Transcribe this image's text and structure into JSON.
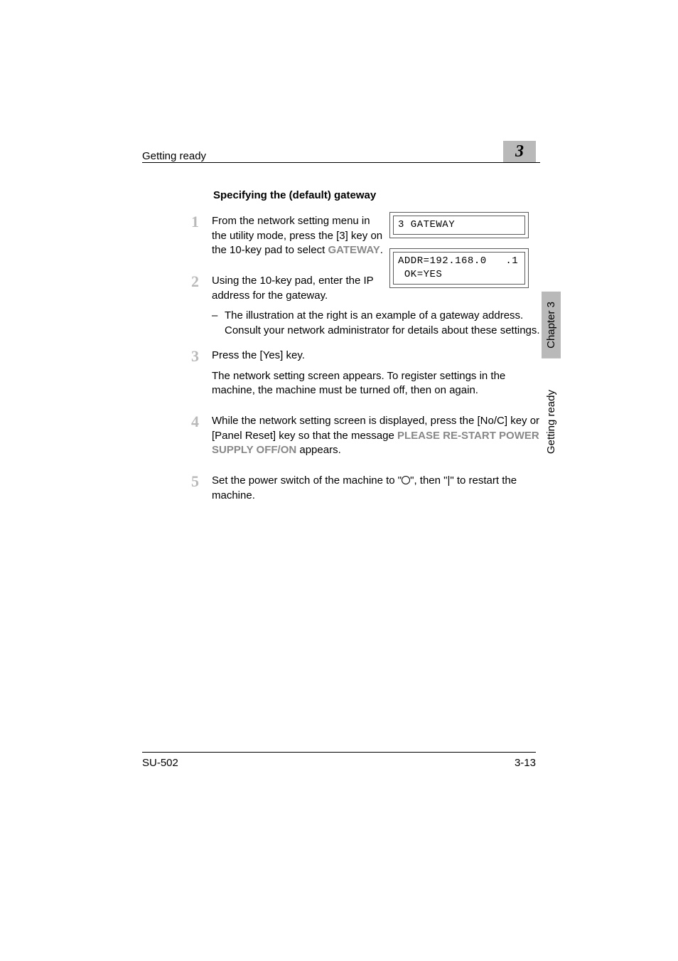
{
  "header": {
    "left": "Getting ready",
    "right_num": "3"
  },
  "section_title": "Specifying the (default) gateway",
  "illus": {
    "box1": "3 GATEWAY",
    "box2_line1": "ADDR=192.168.0   .1",
    "box2_line2": " OK=YES"
  },
  "steps": [
    {
      "num": "1",
      "paras": [
        {
          "segments": [
            {
              "t": "From the network setting menu in the utility mode, press the [3] key on the 10-key pad to select "
            },
            {
              "t": "GATEWAY",
              "gray": true
            },
            {
              "t": "."
            }
          ]
        }
      ]
    },
    {
      "num": "2",
      "paras": [
        {
          "segments": [
            {
              "t": "Using the 10-key pad, enter the IP address for the gateway."
            }
          ]
        }
      ],
      "sub": [
        {
          "segments": [
            {
              "t": "The illustration at the right is an example of a gateway address. Consult your network administrator for details about these settings."
            }
          ]
        }
      ]
    },
    {
      "num": "3",
      "paras": [
        {
          "segments": [
            {
              "t": "Press the [Yes] key."
            }
          ]
        },
        {
          "segments": [
            {
              "t": "The network setting screen appears. To register settings in the machine, the machine must be turned off, then on again."
            }
          ]
        }
      ]
    },
    {
      "num": "4",
      "paras": [
        {
          "segments": [
            {
              "t": "While the network setting screen is displayed, press the [No/C] key or [Panel Reset] key so that the message "
            },
            {
              "t": "PLEASE RE-START POWER SUPPLY OFF/ON",
              "gray": true
            },
            {
              "t": " appears."
            }
          ]
        }
      ]
    },
    {
      "num": "5",
      "paras": [
        {
          "segments": [
            {
              "t": "Set the power switch of the machine to \""
            },
            {
              "circle": true
            },
            {
              "t": "\", then \"|\" to restart the machine."
            }
          ]
        }
      ]
    }
  ],
  "sidetabs": {
    "chapter": "Chapter 3",
    "section": "Getting ready"
  },
  "footer": {
    "left": "SU-502",
    "right": "3-13"
  }
}
